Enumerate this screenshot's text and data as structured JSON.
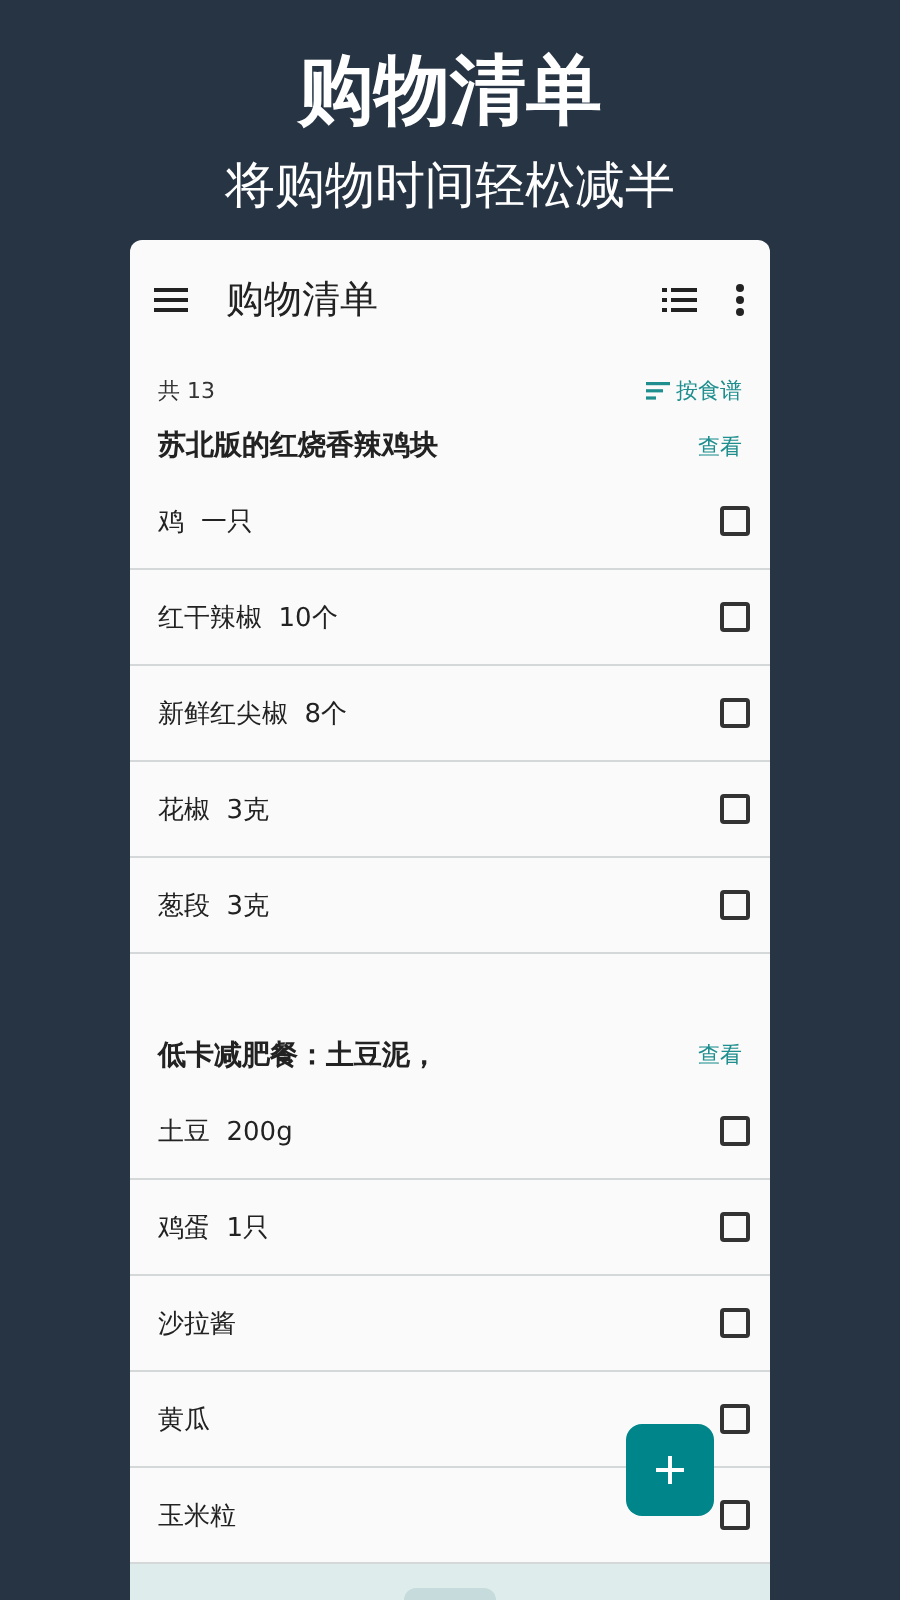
{
  "promo": {
    "title": "购物清单",
    "subtitle": "将购物时间轻松减半"
  },
  "app_bar": {
    "title": "购物清单"
  },
  "summary": {
    "count": "共 13",
    "sort_label": "按食谱"
  },
  "recipes": [
    {
      "name": "苏北版的红烧香辣鸡块",
      "action": "查看",
      "items": [
        {
          "name": "鸡",
          "amount": "一只",
          "checked": false
        },
        {
          "name": "红干辣椒",
          "amount": "10个",
          "checked": false
        },
        {
          "name": "新鲜红尖椒",
          "amount": "8个",
          "checked": false
        },
        {
          "name": "花椒",
          "amount": "3克",
          "checked": false
        },
        {
          "name": "葱段",
          "amount": "3克",
          "checked": false
        }
      ]
    },
    {
      "name": "低卡减肥餐：土豆泥，",
      "action": "查看",
      "items": [
        {
          "name": "土豆",
          "amount": "200g",
          "checked": false
        },
        {
          "name": "鸡蛋",
          "amount": "1只",
          "checked": false
        },
        {
          "name": "沙拉酱",
          "checked": false
        },
        {
          "name": "黄瓜",
          "checked": false
        },
        {
          "name": "玉米粒",
          "checked": false
        }
      ]
    }
  ]
}
